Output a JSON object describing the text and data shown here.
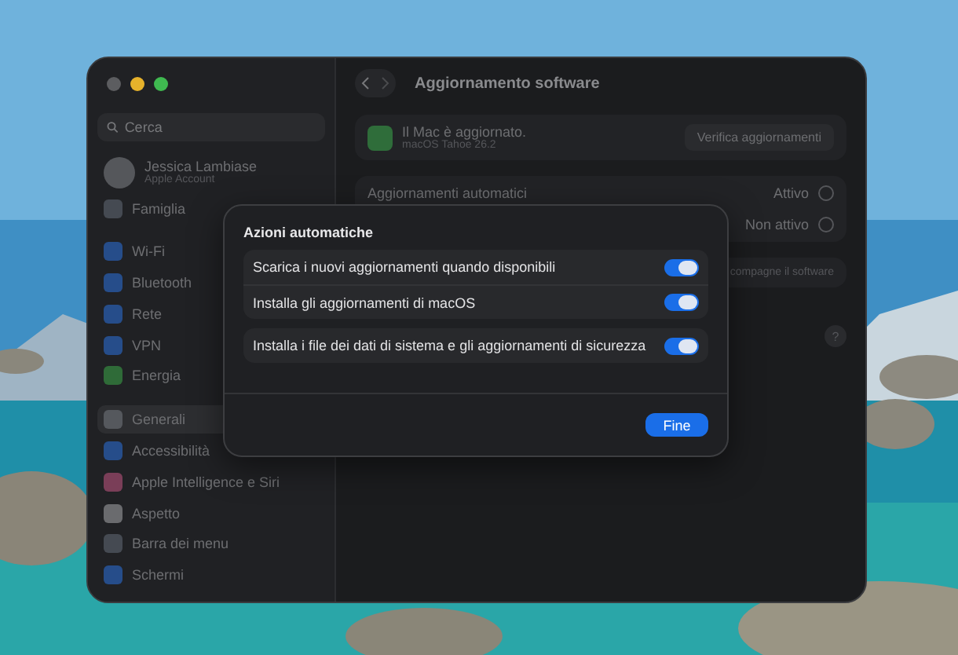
{
  "window": {
    "title": "Aggiornamento software"
  },
  "sidebar": {
    "search": {
      "placeholder": "Cerca"
    },
    "account": {
      "name": "Jessica Lambiase",
      "subtitle": "Apple Account"
    },
    "items": [
      {
        "label": "Famiglia",
        "color": "#454a52",
        "selected": false,
        "divider_before": false
      },
      {
        "label": "Wi-Fi",
        "color": "#264d8a",
        "selected": false,
        "divider_before": true
      },
      {
        "label": "Bluetooth",
        "color": "#264d8a",
        "selected": false,
        "divider_before": false
      },
      {
        "label": "Rete",
        "color": "#264d8a",
        "selected": false,
        "divider_before": false
      },
      {
        "label": "VPN",
        "color": "#264d8a",
        "selected": false,
        "divider_before": false
      },
      {
        "label": "Energia",
        "color": "#2f6b38",
        "selected": false,
        "divider_before": false
      },
      {
        "label": "Generali",
        "color": "#55585d",
        "selected": true,
        "divider_before": true
      },
      {
        "label": "Accessibilità",
        "color": "#264d8a",
        "selected": false,
        "divider_before": false
      },
      {
        "label": "Apple Intelligence e Siri",
        "color": "#7a3e58",
        "selected": false,
        "divider_before": false
      },
      {
        "label": "Aspetto",
        "color": "#6a6b6e",
        "selected": false,
        "divider_before": false
      },
      {
        "label": "Barra dei menu",
        "color": "#454a52",
        "selected": false,
        "divider_before": false
      },
      {
        "label": "Schermi",
        "color": "#264d8a",
        "selected": false,
        "divider_before": false
      }
    ]
  },
  "status": {
    "title": "Il Mac è aggiornato.",
    "subtitle": "macOS Tahoe 26.2",
    "button": "Verifica aggiornamenti"
  },
  "settings": [
    {
      "label": "Aggiornamenti automatici",
      "value": "Attivo"
    },
    {
      "value": "Non attivo"
    }
  ],
  "partial_row": {
    "text": "compagne il software"
  },
  "help": "?",
  "dialog": {
    "title": "Azioni automatiche",
    "groups": [
      [
        {
          "label": "Scarica i nuovi aggiornamenti quando disponibili",
          "on": true
        },
        {
          "label": "Installa gli aggiornamenti di macOS",
          "on": true
        }
      ],
      [
        {
          "label": "Installa i file dei dati di sistema e gli aggiornamenti di sicurezza",
          "on": true
        }
      ]
    ],
    "button": "Fine"
  }
}
